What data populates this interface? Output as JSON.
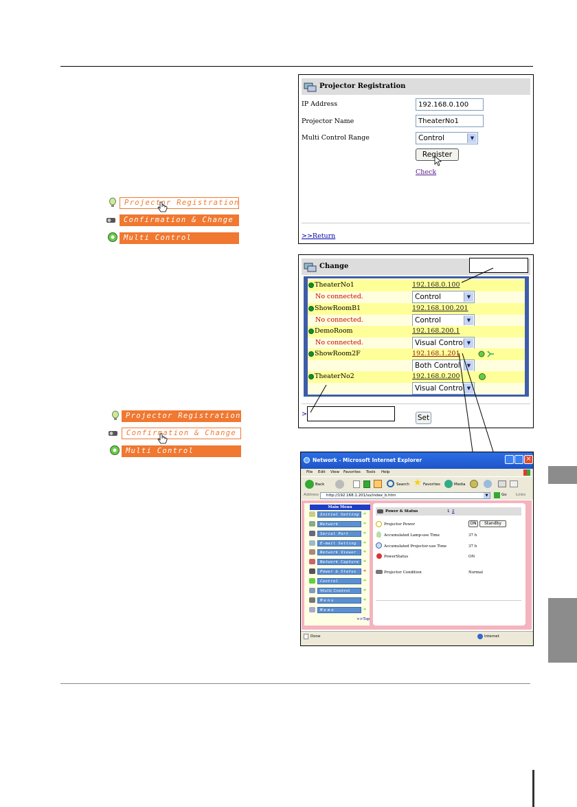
{
  "registration_panel": {
    "title": "Projector Registration",
    "ip_label": "IP Address",
    "ip_value": "192.168.0.100",
    "name_label": "Projector Name",
    "name_value": "TheaterNo1",
    "range_label": "Multi Control Range",
    "range_value": "Control",
    "register_button": "Register",
    "check_link": "Check",
    "return_link": ">>Return"
  },
  "menu_upper": {
    "items": [
      "Projector Registration",
      "Confirmation & Change",
      "Multi Control"
    ],
    "selected": 0
  },
  "menu_lower": {
    "items": [
      "Projector Registration",
      "Confirmation & Change",
      "Multi Control"
    ],
    "selected": 1
  },
  "change_panel": {
    "title": "Change",
    "rows": [
      {
        "name": "TheaterNo1",
        "ip": "192.168.0.100",
        "status": "No connected.",
        "control": "Control"
      },
      {
        "name": "ShowRoomB1",
        "ip": "192.168.100.201",
        "status": "No connected.",
        "control": "Control"
      },
      {
        "name": "DemoRoom",
        "ip": "192.168.200.1",
        "status": "No connected.",
        "control": "Visual Control"
      },
      {
        "name": "ShowRoom2F",
        "ip": "192.168.1.201",
        "status": "",
        "control": "Both Control"
      },
      {
        "name": "TheaterNo2",
        "ip": "192.168.0.200",
        "status": "",
        "control": "Visual Control"
      }
    ],
    "return_prefix": ">>",
    "set_button": "Set"
  },
  "ie_window": {
    "title": "Network - Microsoft Internet Explorer",
    "menu": [
      "File",
      "Edit",
      "View",
      "Favorites",
      "Tools",
      "Help"
    ],
    "toolbar": {
      "back": "Back",
      "search": "Search",
      "favorites": "Favorites",
      "media": "Media"
    },
    "address_label": "Address",
    "address_value": "http://192.168.1.201/us/index_b.htm",
    "go_label": "Go",
    "links_label": "Links",
    "left_menu_title": "Main Menu",
    "left_menu": [
      "Initial Setting",
      "Network",
      "Serial Port",
      "E-mail Setting",
      "Network Viewer",
      "Network Capture",
      "Power & Status",
      "Control",
      "Multi Control",
      "Menu",
      "Memo"
    ],
    "left_menu_selected": 6,
    "top_link": ">>Top",
    "content": {
      "title": "Power & Status",
      "page1": "1",
      "page2": "2",
      "rows": [
        {
          "label": "Projector Power",
          "value": ""
        },
        {
          "label": "Accumulated Lamp-use Time",
          "value": "37 h"
        },
        {
          "label": "Accumulated Projector-use Time",
          "value": "37 h"
        },
        {
          "label": "PowerStatus",
          "value": "ON"
        },
        {
          "label": "Projector Condition",
          "value": "Normal"
        }
      ],
      "on_button": "ON",
      "standby_button": "Standby"
    },
    "status_done": "Done",
    "status_zone": "Internet"
  },
  "colors": {
    "menu_orange": "#f07830",
    "side_tab": "#8c8c8c",
    "change_frame": "#3e5ca8",
    "row_yellow": "#ffff99"
  }
}
